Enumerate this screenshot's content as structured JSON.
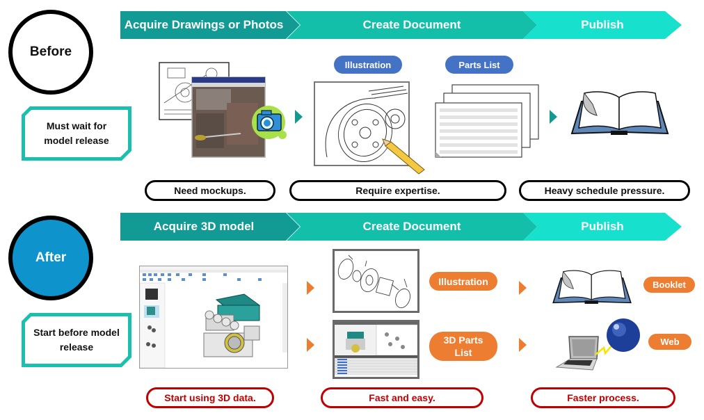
{
  "before": {
    "label": "Before",
    "note": "Must wait for model release",
    "steps": [
      "Acquire Drawings or Photos",
      "Create Document",
      "Publish"
    ],
    "tags": [
      "Illustration",
      "Parts List"
    ],
    "callouts": [
      "Need mockups.",
      "Require expertise.",
      "Heavy schedule pressure."
    ],
    "icons": [
      "drawing-and-photo-icon",
      "camera-icon",
      "pencil-illustration-icon",
      "document-stack-icon",
      "open-book-icon"
    ]
  },
  "after": {
    "label": "After",
    "note": "Start before model release",
    "steps": [
      "Acquire 3D model",
      "Create Document",
      "Publish"
    ],
    "outputs_create": [
      "Illustration",
      "3D Parts List"
    ],
    "outputs_publish": [
      "Booklet",
      "Web"
    ],
    "callouts": [
      "Start using 3D data.",
      "Fast and easy.",
      "Faster process."
    ],
    "icons": [
      "cad-software-window-icon",
      "exploded-view-icon",
      "parts-list-screen-icon",
      "open-book-icon",
      "laptop-globe-icon"
    ]
  },
  "colors": {
    "step1": "#129a94",
    "step2": "#14bfa9",
    "step3": "#17e0cd",
    "note_border": "#1bbfad",
    "after_circle": "#0e93cd",
    "tag_blue": "#4472c4",
    "tag_orange": "#ed7d31",
    "callout_red": "#c00000"
  }
}
